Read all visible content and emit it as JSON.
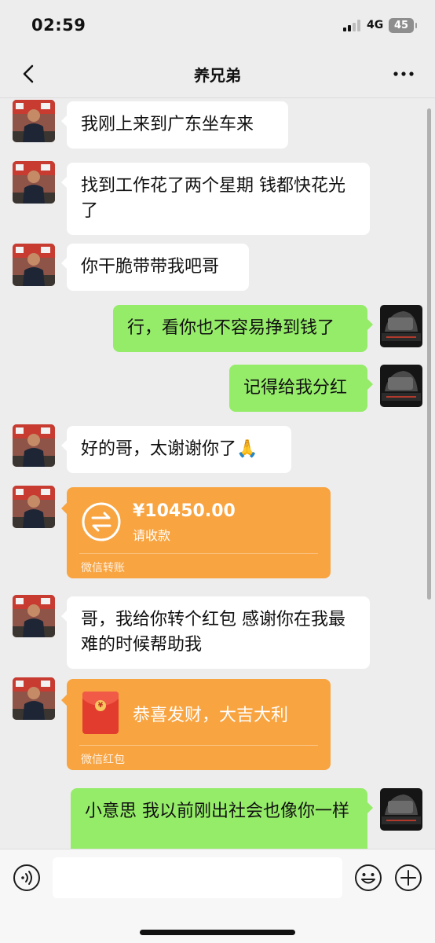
{
  "status_bar": {
    "time": "02:59",
    "network": "4G",
    "battery": "45"
  },
  "header": {
    "title": "养兄弟"
  },
  "messages": [
    {
      "side": "in",
      "type": "text",
      "text": "我刚上来到广东坐车来"
    },
    {
      "side": "in",
      "type": "text",
      "text": "找到工作花了两个星期 钱都快花光了"
    },
    {
      "side": "in",
      "type": "text",
      "text": "你干脆带带我吧哥"
    },
    {
      "side": "out",
      "type": "text",
      "text": "行，看你也不容易挣到钱了"
    },
    {
      "side": "out",
      "type": "text",
      "text": "记得给我分红"
    },
    {
      "side": "in",
      "type": "text",
      "text": "好的哥，太谢谢你了🙏"
    },
    {
      "side": "in",
      "type": "transfer",
      "amount": "¥10450.00",
      "status": "请收款",
      "footer": "微信转账"
    },
    {
      "side": "in",
      "type": "text",
      "text": "哥，我给你转个红包 感谢你在我最难的时候帮助我"
    },
    {
      "side": "in",
      "type": "red_packet",
      "greeting": "恭喜发财，大吉大利",
      "footer": "微信红包"
    },
    {
      "side": "out",
      "type": "text",
      "text": "小意思 我以前刚出社会也像你一样"
    }
  ],
  "colors": {
    "outgoing": "#95ec69",
    "incoming": "#ffffff",
    "transfer": "#f8a441",
    "background": "#ededed"
  },
  "icons": [
    "back-arrow-icon",
    "more-icon",
    "transfer-arrows-icon",
    "red-packet-icon",
    "voice-icon",
    "emoji-icon",
    "plus-icon"
  ]
}
